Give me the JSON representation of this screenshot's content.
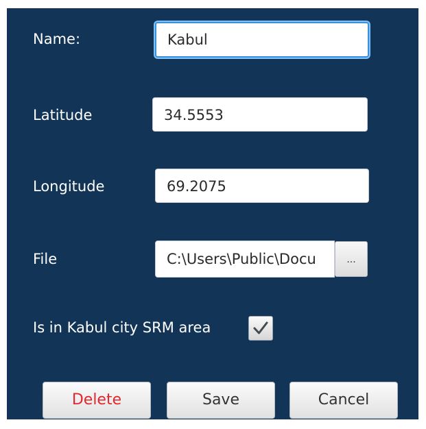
{
  "form": {
    "name_label": "Name:",
    "name_value": "Kabul",
    "latitude_label": "Latitude",
    "latitude_value": "34.5553",
    "longitude_label": "Longitude",
    "longitude_value": "69.2075",
    "file_label": "File",
    "file_value": "C:\\Users\\Public\\Docu",
    "browse_label": "...",
    "srm_label": "Is in Kabul city SRM area",
    "srm_checked": true
  },
  "buttons": {
    "delete_label": "Delete",
    "save_label": "Save",
    "cancel_label": "Cancel"
  },
  "colors": {
    "background": "#123456",
    "focus_ring": "#7fc0ff",
    "delete_text": "#e0282e"
  },
  "icons": {
    "checkbox": "checkmark-icon"
  }
}
